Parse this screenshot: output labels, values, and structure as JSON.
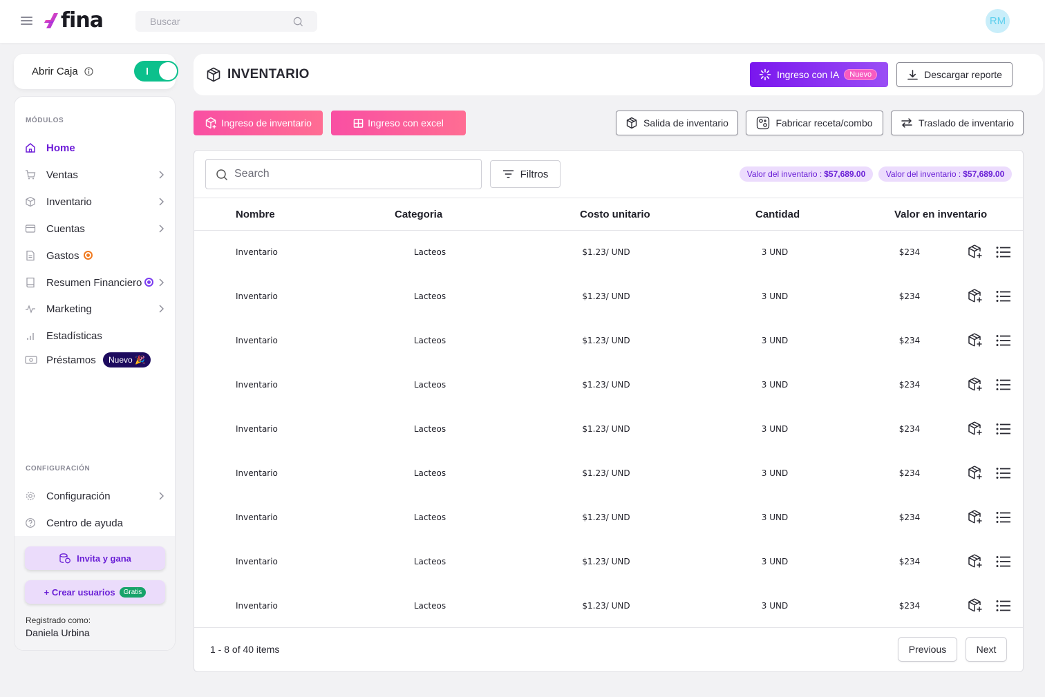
{
  "topbar": {
    "logo_text": "fina",
    "search_placeholder": "Buscar",
    "avatar_initials": "RM"
  },
  "caja": {
    "label": "Abrir Caja",
    "toggle_on": true
  },
  "sidebar": {
    "modules_title": "MÓDULOS",
    "items": [
      {
        "label": "Home",
        "icon": "home-icon",
        "active": true
      },
      {
        "label": "Ventas",
        "icon": "cart-icon",
        "chevron": true
      },
      {
        "label": "Inventario",
        "icon": "box-icon",
        "chevron": true
      },
      {
        "label": "Cuentas",
        "icon": "card-icon",
        "chevron": true
      },
      {
        "label": "Gastos",
        "icon": "document-icon",
        "indicator": "orange"
      },
      {
        "label": "Resumen Financiero",
        "icon": "book-icon",
        "indicator": "purple",
        "chevron": true
      },
      {
        "label": "Marketing",
        "icon": "pulse-icon",
        "chevron": true
      },
      {
        "label": "Estadísticas",
        "icon": "bar-chart-icon"
      },
      {
        "label": "Préstamos",
        "icon": "money-icon",
        "badge": "Nuevo 🎉"
      }
    ],
    "config_title": "CONFIGURACIÓN",
    "config_items": [
      {
        "label": "Configuración",
        "icon": "gear-icon",
        "chevron": true
      },
      {
        "label": "Centro de ayuda",
        "icon": "help-icon"
      }
    ],
    "invite_label": "Invita y gana",
    "create_users_label": "+ Crear usuarios",
    "create_users_badge": "Gratis",
    "registered_label": "Registrado como:",
    "registered_name": "Daniela Urbina"
  },
  "header": {
    "title": "INVENTARIO",
    "ia_button": "Ingreso con IA",
    "ia_badge": "Nuevo",
    "download_button": "Descargar reporte"
  },
  "actions": {
    "ingreso_inventario": "Ingreso de inventario",
    "ingreso_excel": "Ingreso con excel",
    "salida": "Salida de inventario",
    "fabricar": "Fabricar receta/combo",
    "traslado": "Traslado de inventario"
  },
  "table": {
    "search_placeholder": "Search",
    "filters_label": "Filtros",
    "chips": [
      {
        "label": "Valor del inventario :",
        "value": "$57,689.00"
      },
      {
        "label": "Valor del inventario :",
        "value": "$57,689.00"
      }
    ],
    "columns": [
      "Nombre",
      "Categoria",
      "Costo unitario",
      "Cantidad",
      "Valor en inventario"
    ],
    "rows": [
      {
        "nombre": "Inventario",
        "categoria": "Lacteos",
        "costo": "$1.23/ UND",
        "cantidad": "3 UND",
        "valor": "$234"
      },
      {
        "nombre": "Inventario",
        "categoria": "Lacteos",
        "costo": "$1.23/ UND",
        "cantidad": "3 UND",
        "valor": "$234"
      },
      {
        "nombre": "Inventario",
        "categoria": "Lacteos",
        "costo": "$1.23/ UND",
        "cantidad": "3 UND",
        "valor": "$234"
      },
      {
        "nombre": "Inventario",
        "categoria": "Lacteos",
        "costo": "$1.23/ UND",
        "cantidad": "3 UND",
        "valor": "$234"
      },
      {
        "nombre": "Inventario",
        "categoria": "Lacteos",
        "costo": "$1.23/ UND",
        "cantidad": "3 UND",
        "valor": "$234"
      },
      {
        "nombre": "Inventario",
        "categoria": "Lacteos",
        "costo": "$1.23/ UND",
        "cantidad": "3 UND",
        "valor": "$234"
      },
      {
        "nombre": "Inventario",
        "categoria": "Lacteos",
        "costo": "$1.23/ UND",
        "cantidad": "3 UND",
        "valor": "$234"
      },
      {
        "nombre": "Inventario",
        "categoria": "Lacteos",
        "costo": "$1.23/ UND",
        "cantidad": "3 UND",
        "valor": "$234"
      },
      {
        "nombre": "Inventario",
        "categoria": "Lacteos",
        "costo": "$1.23/ UND",
        "cantidad": "3 UND",
        "valor": "$234"
      }
    ],
    "pagination_text": "1 - 8 of 40 items",
    "previous_label": "Previous",
    "next_label": "Next"
  },
  "colors": {
    "brand_purple": "#6e1ed8",
    "brand_pink": "#f94fa3",
    "toggle_green": "#0cc08c"
  }
}
